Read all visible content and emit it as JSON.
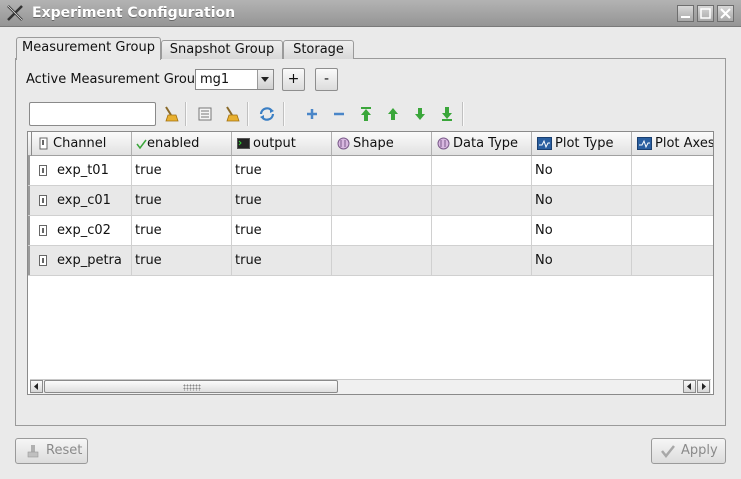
{
  "window": {
    "title": "Experiment Configuration"
  },
  "tabs": [
    {
      "label": "Measurement Group",
      "active": true
    },
    {
      "label": "Snapshot Group",
      "active": false
    },
    {
      "label": "Storage",
      "active": false
    }
  ],
  "active_group": {
    "label": "Active Measurement Group",
    "value": "mg1",
    "add_label": "+",
    "remove_label": "-"
  },
  "filter": {
    "value": ""
  },
  "toolbar": {
    "icons": [
      "clear-filter-icon",
      "select-all-icon",
      "clear-all-icon",
      "refresh-icon",
      "add-channel-icon",
      "remove-channel-icon",
      "move-top-icon",
      "move-up-icon",
      "move-down-icon",
      "move-bottom-icon"
    ]
  },
  "table": {
    "columns": [
      {
        "label": "Channel",
        "icon": "channel-icon"
      },
      {
        "label": "enabled",
        "icon": "checkmark-icon"
      },
      {
        "label": "output",
        "icon": "terminal-icon"
      },
      {
        "label": "Shape",
        "icon": "shape-icon"
      },
      {
        "label": "Data Type",
        "icon": "data-type-icon"
      },
      {
        "label": "Plot Type",
        "icon": "plot-type-icon"
      },
      {
        "label": "Plot Axes",
        "icon": "plot-axes-icon"
      }
    ],
    "rows": [
      {
        "channel": "exp_t01",
        "enabled": "true",
        "output": "true",
        "shape": "",
        "data_type": "",
        "plot_type": "No",
        "plot_axes": ""
      },
      {
        "channel": "exp_c01",
        "enabled": "true",
        "output": "true",
        "shape": "",
        "data_type": "",
        "plot_type": "No",
        "plot_axes": ""
      },
      {
        "channel": "exp_c02",
        "enabled": "true",
        "output": "true",
        "shape": "",
        "data_type": "",
        "plot_type": "No",
        "plot_axes": ""
      },
      {
        "channel": "exp_petra",
        "enabled": "true",
        "output": "true",
        "shape": "",
        "data_type": "",
        "plot_type": "No",
        "plot_axes": ""
      }
    ]
  },
  "buttons": {
    "reset": "Reset",
    "apply": "Apply"
  },
  "colors": {
    "titlebar": "#a4a4a4",
    "window_bg": "#eaeaea",
    "row_alt": "#e8e8e8",
    "toolbar_icon_green": "#3aa63a",
    "toolbar_icon_blue": "#3b7fc4"
  }
}
